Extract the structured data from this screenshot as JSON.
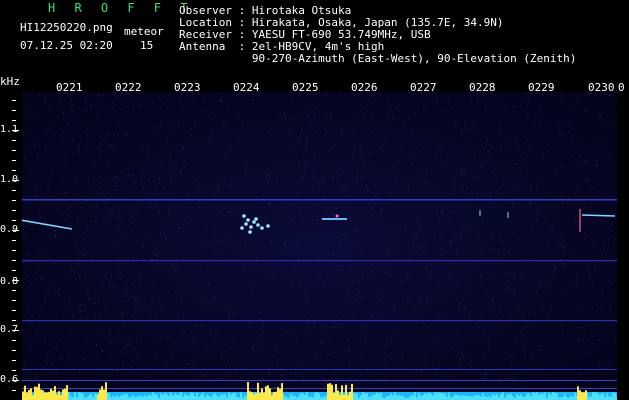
{
  "header": {
    "title": "H R O F F T",
    "filename": "HI12250220.png",
    "datetime": "07.12.25 02:20",
    "meteor_label": "meteor",
    "meteor_count": "15",
    "observer": "Observer : Hirotaka Otsuka",
    "location": "Location : Hirakata, Osaka, Japan (135.7E, 34.9N)",
    "receiver": "Receiver : YAESU FT-690 53.749MHz, USB",
    "antenna": "Antenna  : 2el-HB9CV, 4m's high",
    "antenna2": "           90-270-Azimuth (East-West), 90-Elevation (Zenith)"
  },
  "axes": {
    "y_unit": "kHz",
    "x_ticks": [
      "0221",
      "0222",
      "0223",
      "0224",
      "0225",
      "0226",
      "0227",
      "0228",
      "0229",
      "0230"
    ],
    "x_end": "0",
    "y_ticks": [
      "1.1",
      "1.0",
      "0.9",
      "0.8",
      "0.7",
      "0.6"
    ]
  },
  "colors": {
    "background": "#000000",
    "header_green": "#33e06a",
    "spectrum": "#0a0a38",
    "echo": "#7fd8ff"
  }
}
